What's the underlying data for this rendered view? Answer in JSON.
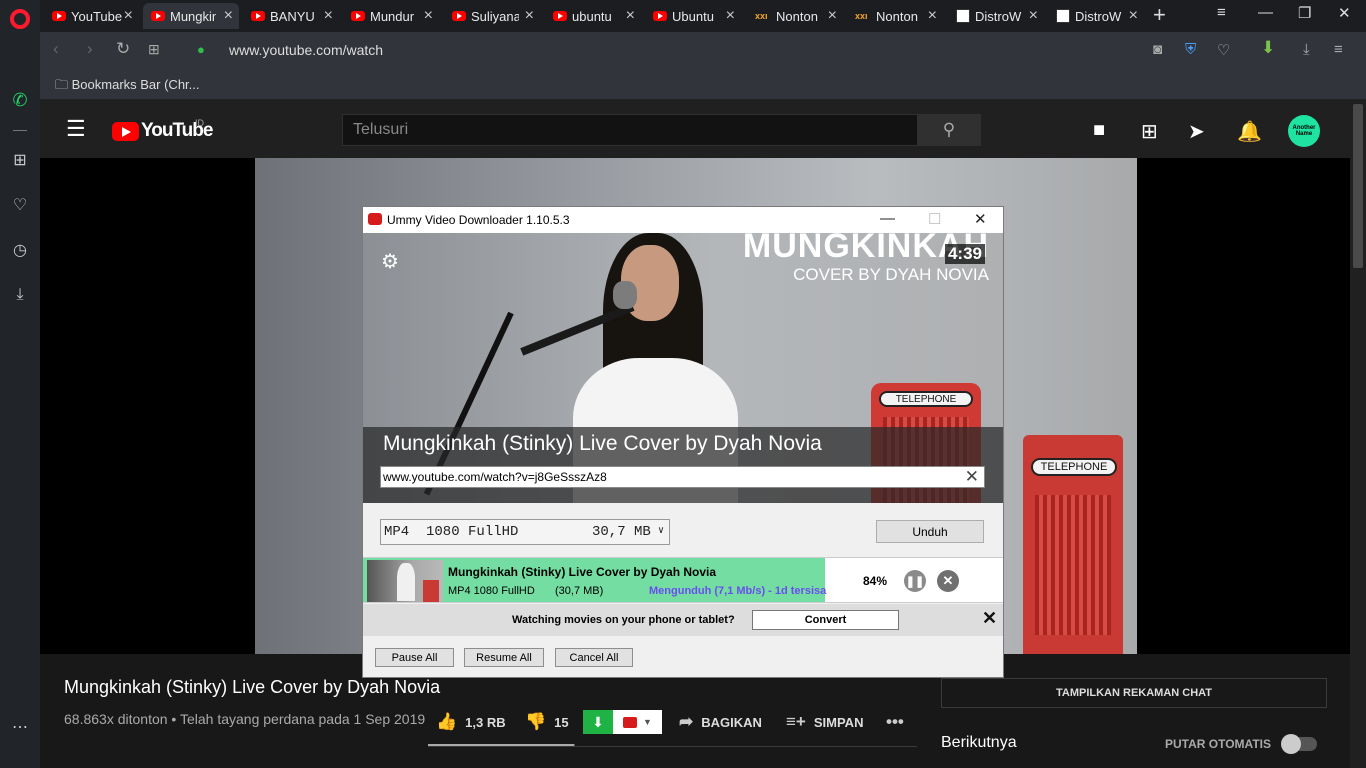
{
  "tabs": [
    {
      "label": "YouTube",
      "icon": "youtube-icon",
      "active": false
    },
    {
      "label": "Mungkin",
      "icon": "youtube-icon",
      "active": true
    },
    {
      "label": "BANYU L",
      "icon": "youtube-icon",
      "active": false
    },
    {
      "label": "Mundur",
      "icon": "youtube-icon",
      "active": false
    },
    {
      "label": "Suliyana",
      "icon": "youtube-icon",
      "active": false
    },
    {
      "label": "ubuntu",
      "icon": "youtube-icon",
      "active": false
    },
    {
      "label": "Ubuntu",
      "icon": "youtube-icon",
      "active": false
    },
    {
      "label": "Nonton",
      "icon": "nonton-icon",
      "active": false
    },
    {
      "label": "Nonton",
      "icon": "nonton-icon",
      "active": false
    },
    {
      "label": "DistroW",
      "icon": "distrowatch-icon",
      "active": false
    },
    {
      "label": "DistroW",
      "icon": "distrowatch-icon",
      "active": false
    }
  ],
  "browser": {
    "url": "www.youtube.com/watch",
    "bookmarks_bar": "Bookmarks Bar (Chr..."
  },
  "youtube": {
    "logo_text": "YouTube",
    "region": "ID",
    "search_placeholder": "Telusuri",
    "avatar_text": "Another Name"
  },
  "video": {
    "title": "Mungkinkah (Stinky) Live Cover by Dyah Novia",
    "meta": "68.863x ditonton • Telah tayang perdana pada 1 Sep 2019",
    "likes": "1,3 RB",
    "dislikes": "15",
    "like_ratio": 0.99,
    "share": "BAGIKAN",
    "save": "SIMPAN",
    "phone_label": "TELEPHONE"
  },
  "sidebar_right": {
    "chat_button": "TAMPILKAN REKAMAN CHAT",
    "up_next": "Berikutnya",
    "autoplay": "PUTAR OTOMATIS"
  },
  "ummy": {
    "window_title": "Ummy Video Downloader 1.10.5.3",
    "preview_title_big": "MUNGKINKAH",
    "preview_subtitle": "COVER BY DYAH NOVIA",
    "preview_duration": "4:39",
    "preview_phone_label": "TELEPHONE",
    "video_title": "Mungkinkah (Stinky) Live Cover by Dyah Novia",
    "url": "www.youtube.com/watch?v=j8GeSsszAz8",
    "format_left": "MP4  1080 FullHD",
    "format_right": "30,7 MB",
    "download_button": "Unduh",
    "download_item": {
      "name": "Mungkinkah (Stinky) Live Cover by Dyah Novia",
      "format": "MP4  1080 FullHD",
      "size": "(30,7 MB)",
      "status": "Mengunduh (7,1 Mb/s) - 1d tersisa",
      "percent_text": "84%",
      "progress": 0.84
    },
    "promo_text": "Watching movies on your phone or tablet?",
    "convert_button": "Convert",
    "pause_all": "Pause All",
    "resume_all": "Resume All",
    "cancel_all": "Cancel All"
  }
}
